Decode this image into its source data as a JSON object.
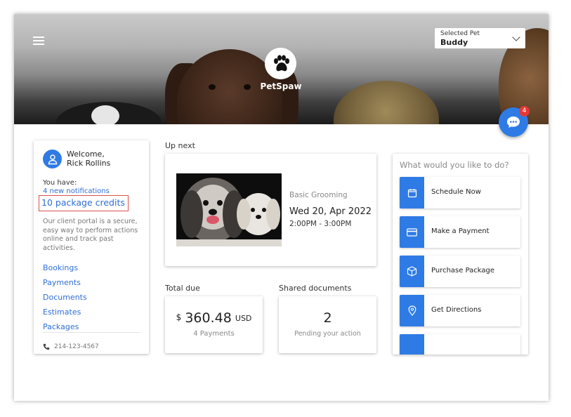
{
  "header": {
    "selected_pet_label": "Selected Pet",
    "selected_pet": "Buddy",
    "brand": "PetSpaw",
    "chat_badge_count": "4"
  },
  "sidebar": {
    "welcome_line1": "Welcome,",
    "welcome_line2": "Rick Rollins",
    "you_have": "You have:",
    "notifications": "4 new notifications",
    "credits": "10 package credits",
    "description": "Our client portal is a secure, easy way to perform actions online and track past activities.",
    "links": [
      "Bookings",
      "Payments",
      "Documents",
      "Estimates",
      "Packages"
    ],
    "phone": "214-123-4567"
  },
  "upnext": {
    "label": "Up next",
    "service": "Basic Grooming",
    "date": "Wed 20, Apr 2022",
    "time": "2:00PM - 3:00PM"
  },
  "total_due": {
    "label": "Total due",
    "currency_symbol": "$",
    "amount": "360.48",
    "currency": "USD",
    "sub": "4 Payments"
  },
  "shared_docs": {
    "label": "Shared documents",
    "count": "2",
    "sub": "Pending your action"
  },
  "actions": {
    "title": "What would you like to do?",
    "items": [
      {
        "label": "Schedule Now",
        "icon": "calendar-icon"
      },
      {
        "label": "Make a Payment",
        "icon": "credit-card-icon"
      },
      {
        "label": "Purchase Package",
        "icon": "package-box-icon"
      },
      {
        "label": "Get Directions",
        "icon": "location-pin-icon"
      },
      {
        "label": "",
        "icon": "action-icon"
      }
    ]
  },
  "colors": {
    "primary": "#2f7be5",
    "link": "#2f6fd6",
    "badge": "#e53935",
    "highlight_border": "#d9534f"
  }
}
